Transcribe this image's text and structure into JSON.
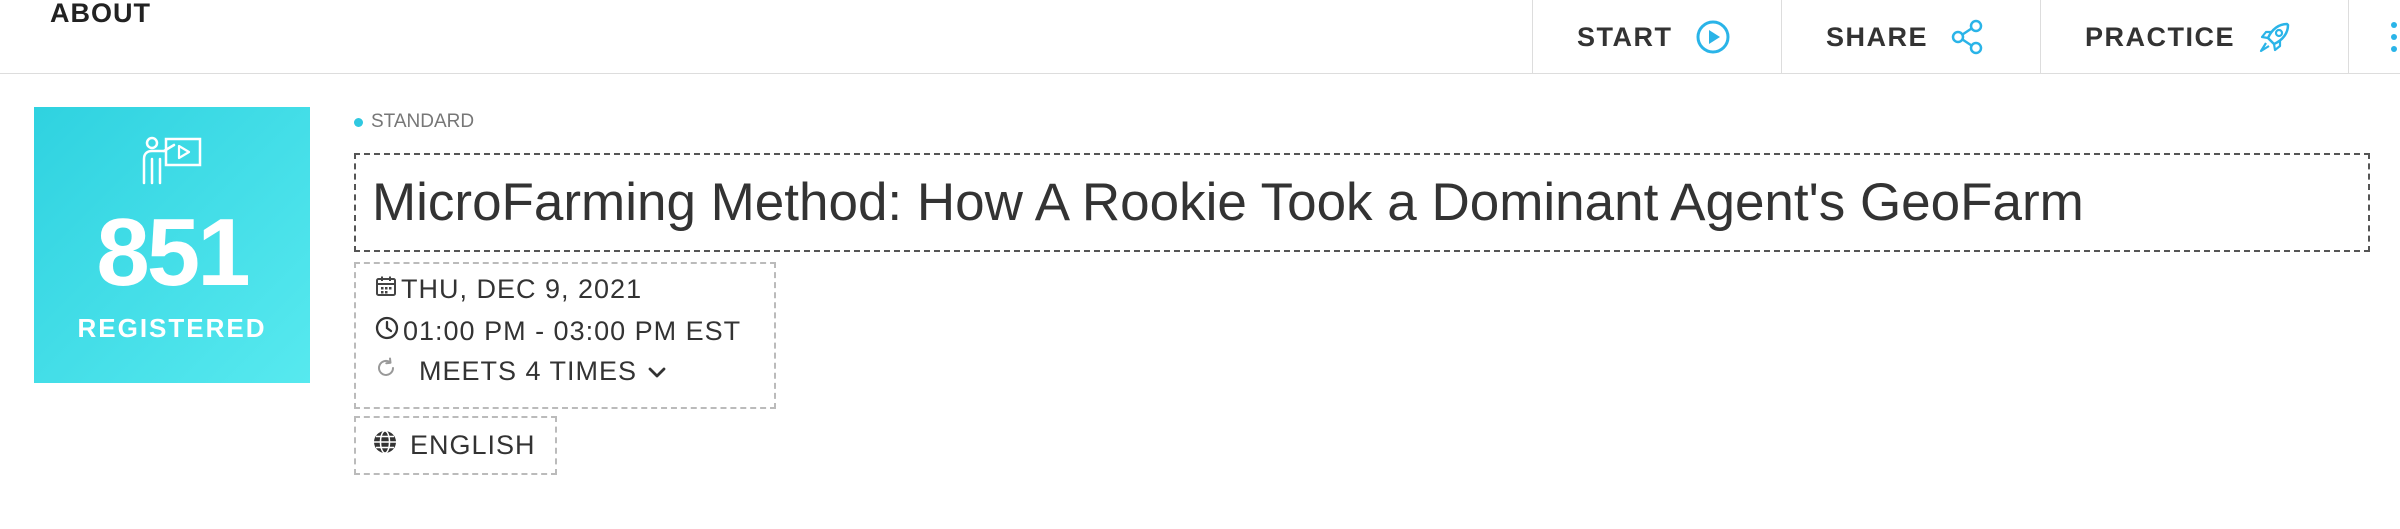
{
  "nav": {
    "about_label": "ABOUT"
  },
  "actions": {
    "start_label": "START",
    "share_label": "SHARE",
    "practice_label": "PRACTICE",
    "accent_color": "#2ab4e8"
  },
  "registration": {
    "count": "851",
    "label": "REGISTERED",
    "icon": "presenter-icon",
    "colors": [
      "#2fd2e0",
      "#57e9ef"
    ]
  },
  "event": {
    "tier": "STANDARD",
    "title": "MicroFarming Method: How A Rookie Took a Dominant Agent's GeoFarm",
    "date": "THU, DEC 9, 2021",
    "time": "01:00 PM - 03:00 PM EST",
    "recurrence": "MEETS 4 TIMES",
    "language": "ENGLISH"
  }
}
